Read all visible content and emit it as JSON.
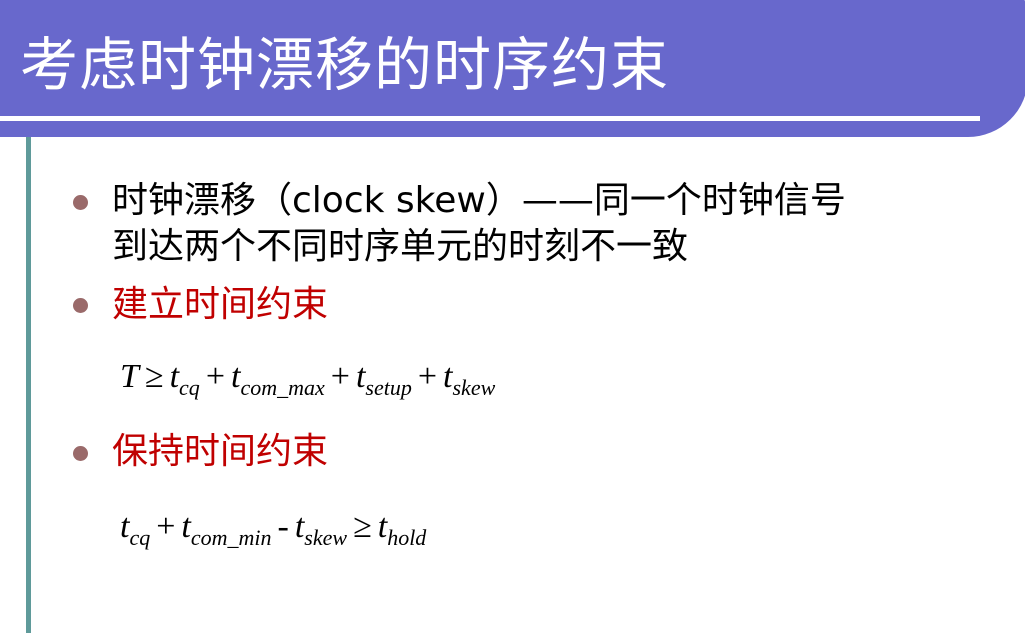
{
  "title": "考虑时钟漂移的时序约束",
  "colors": {
    "header": "#6868cc",
    "accent_line": "#5f9a9a",
    "bullet": "#9a6a6a",
    "heading_red": "#c00000"
  },
  "bullets": [
    {
      "line1": "时钟漂移（clock skew）——同一个时钟信号",
      "line2": "到达两个不同时序单元的时刻不一致"
    },
    {
      "text": "建立时间约束"
    },
    {
      "text": "保持时间约束"
    }
  ],
  "setup_eq": {
    "T": "T",
    "ge": "≥",
    "t": "t",
    "cq": "cq",
    "plus": "+",
    "com_max": "com_max",
    "setup": "setup",
    "skew": "skew"
  },
  "hold_eq": {
    "t": "t",
    "cq": "cq",
    "plus": "+",
    "com_min": "com_min",
    "minus": "-",
    "skew": "skew",
    "ge": "≥",
    "hold": "hold"
  }
}
